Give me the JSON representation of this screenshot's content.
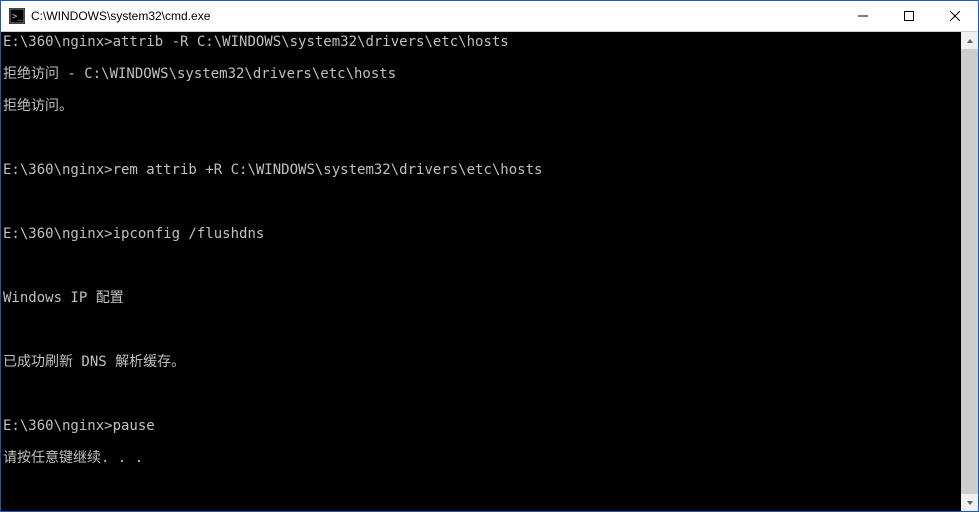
{
  "titlebar": {
    "icon_name": "cmd-icon",
    "title": "C:\\WINDOWS\\system32\\cmd.exe",
    "minimize_label": "Minimize",
    "maximize_label": "Maximize",
    "close_label": "Close"
  },
  "terminal": {
    "lines": [
      {
        "prompt": "E:\\360\\nginx>",
        "cmd": "attrib -R C:\\WINDOWS\\system32\\drivers\\etc\\hosts"
      },
      {
        "out": "拒绝访问 - C:\\WINDOWS\\system32\\drivers\\etc\\hosts"
      },
      {
        "out": "拒绝访问。"
      },
      {
        "out": ""
      },
      {
        "prompt": "E:\\360\\nginx>",
        "cmd": "rem attrib +R C:\\WINDOWS\\system32\\drivers\\etc\\hosts"
      },
      {
        "out": ""
      },
      {
        "prompt": "E:\\360\\nginx>",
        "cmd": "ipconfig /flushdns"
      },
      {
        "out": ""
      },
      {
        "out": "Windows IP 配置"
      },
      {
        "out": ""
      },
      {
        "out": "已成功刷新 DNS 解析缓存。"
      },
      {
        "out": ""
      },
      {
        "prompt": "E:\\360\\nginx>",
        "cmd": "pause"
      },
      {
        "out": "请按任意键继续. . ."
      }
    ]
  },
  "scrollbar": {
    "up_label": "Scroll Up",
    "down_label": "Scroll Down"
  }
}
